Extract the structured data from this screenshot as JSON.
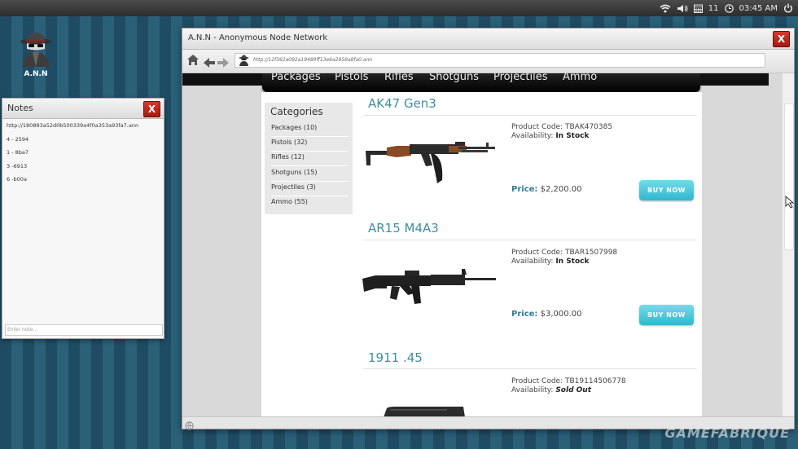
{
  "top_panel": {
    "badge": "11",
    "clock": "03:45 AM"
  },
  "desktop": {
    "icon_label": "A.N.N"
  },
  "notes": {
    "title": "Notes",
    "close": "X",
    "lines": [
      "http://180883a52d0b500339a4f0a353a93fa7.ann",
      "4 - 2594",
      "1 - 8ba7",
      "3 -6913",
      "6 -b00a"
    ],
    "input_placeholder": "Enter note..."
  },
  "browser": {
    "title": "A.N.N - Anonymous Node Network",
    "close": "X",
    "url": "http://12f362a092a19489ff13e6a2858a8fa0.ann"
  },
  "nav": [
    "Packages",
    "Pistols",
    "Rifles",
    "Shotguns",
    "Projectiles",
    "Ammo"
  ],
  "categories": {
    "title": "Categories",
    "items": [
      "Packages (10)",
      "Pistols (32)",
      "Rifles (12)",
      "Shotguns (15)",
      "Projectiles (3)",
      "Ammo (55)"
    ]
  },
  "labels": {
    "product_code": "Product Code:",
    "availability": "Availability:",
    "price": "Price:",
    "buy_now": "BUY NOW"
  },
  "products": [
    {
      "name": "AK47 Gen3",
      "code": "TBAK470385",
      "availability": "In Stock",
      "price": "$2,200.00"
    },
    {
      "name": "AR15 M4A3",
      "code": "TBAR1507998",
      "availability": "In Stock",
      "price": "$3,000.00"
    },
    {
      "name": "1911 .45",
      "code": "TB19114506778",
      "availability": "Sold Out"
    }
  ],
  "watermark": "GAMEFABRIQUE"
}
